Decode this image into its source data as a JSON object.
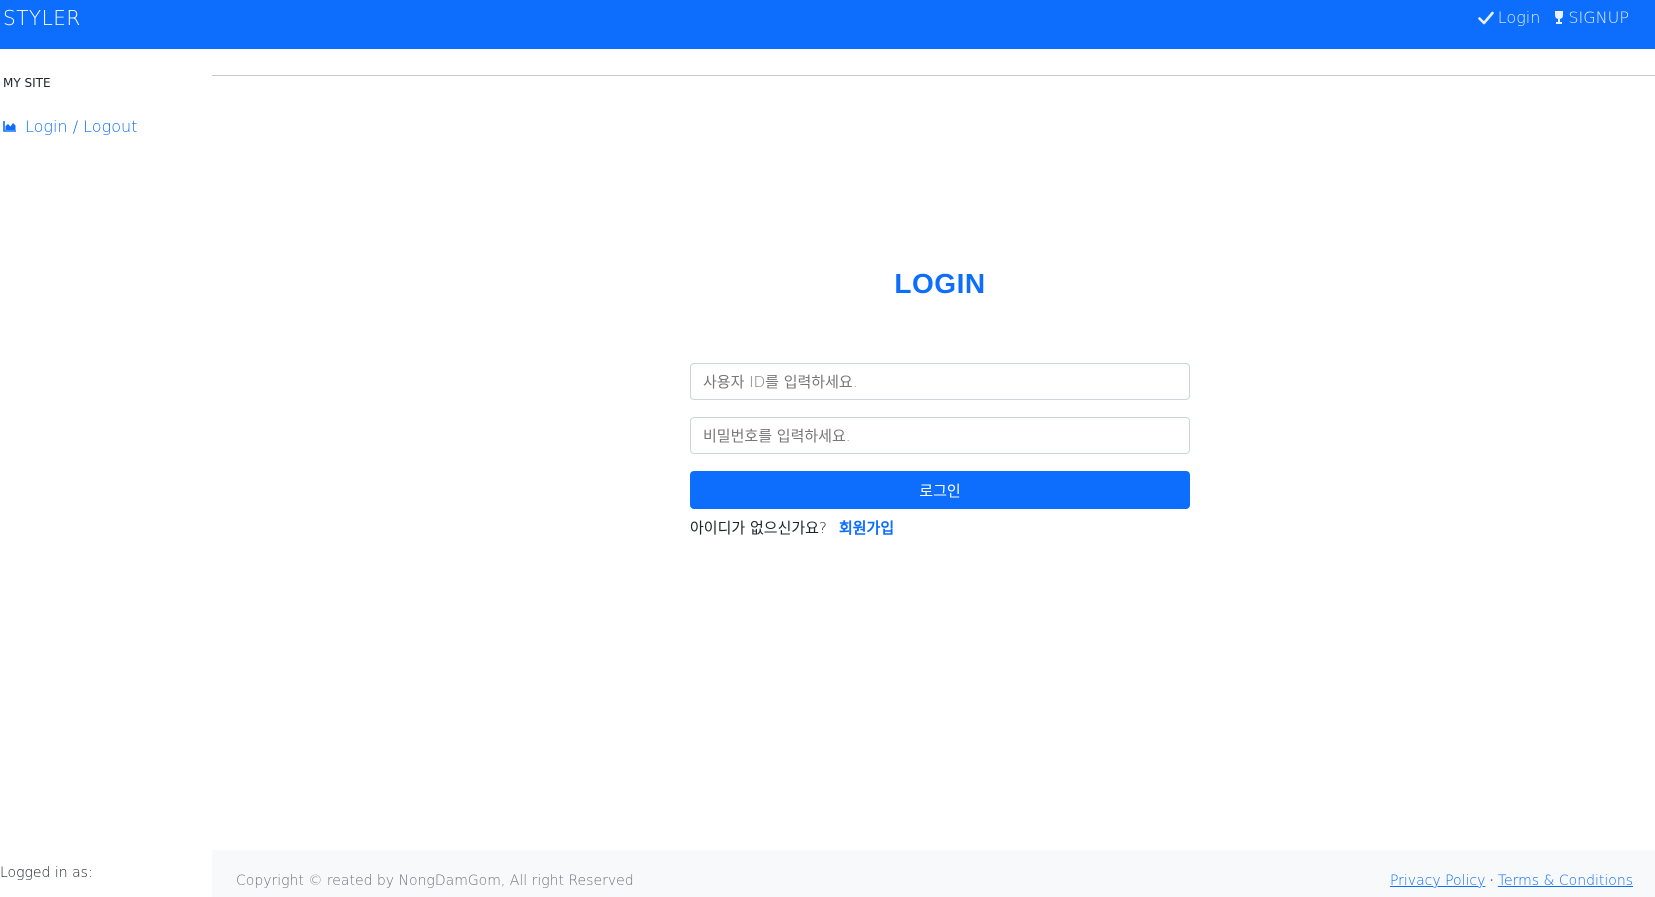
{
  "navbar": {
    "brand": "STYLER",
    "links": [
      {
        "label": "Login",
        "icon": "check-icon"
      },
      {
        "label": "SIGNUP",
        "icon": "trophy-icon"
      }
    ]
  },
  "sidebar": {
    "heading": "MY SITE",
    "items": [
      {
        "label": "Login / Logout",
        "icon": "chart-area-icon"
      }
    ],
    "footer_text": "Logged in as:"
  },
  "login": {
    "title": "LOGIN",
    "id_placeholder": "사용자 ID를 입력하세요.",
    "password_placeholder": "비밀번호를 입력하세요.",
    "submit_label": "로그인",
    "signup_prompt": "아이디가 없으신가요?",
    "signup_link": "회원가입"
  },
  "footer": {
    "copyright": "Copyright © reated by NongDamGom, All right Reserved",
    "privacy": "Privacy Policy",
    "separator": "·",
    "terms": "Terms & Conditions"
  },
  "colors": {
    "primary": "#0d6efd",
    "footer_bg": "#f8f9fa"
  }
}
